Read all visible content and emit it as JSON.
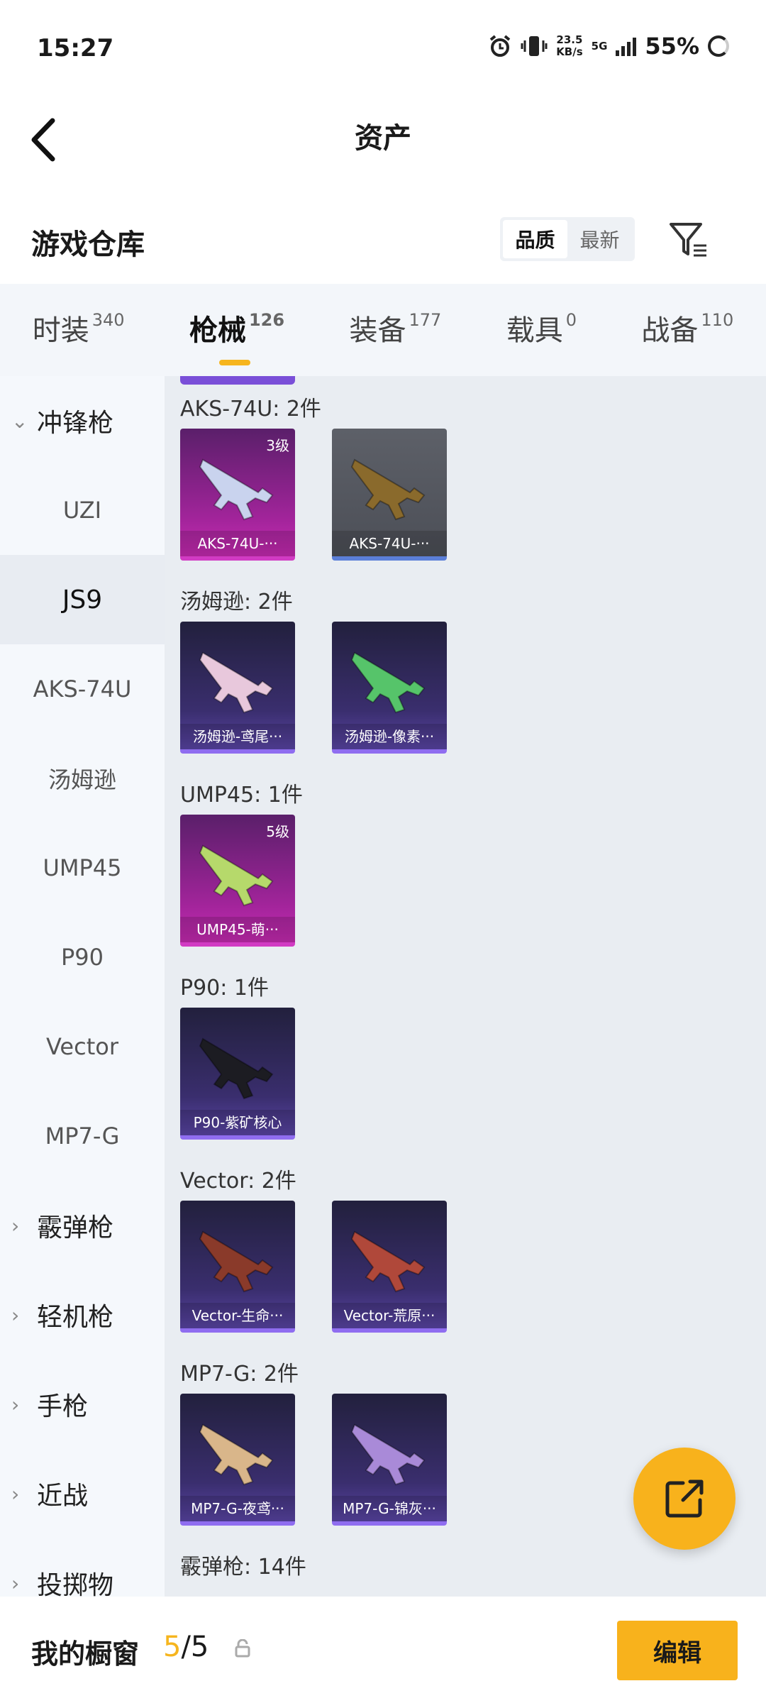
{
  "status_bar": {
    "time": "15:27",
    "net_speed_value": "23.5",
    "net_speed_unit": "KB/s",
    "network": "5G",
    "battery": "55%"
  },
  "header": {
    "title": "资产"
  },
  "warehouse": {
    "title": "游戏仓库",
    "sort_options": [
      "品质",
      "最新"
    ],
    "selected_sort": "品质"
  },
  "tabs": [
    {
      "label": "时装",
      "count": "340"
    },
    {
      "label": "枪械",
      "count": "126",
      "active": true
    },
    {
      "label": "装备",
      "count": "177"
    },
    {
      "label": "载具",
      "count": "0"
    },
    {
      "label": "战备",
      "count": "110"
    }
  ],
  "sidebar": {
    "items": [
      {
        "label": "冲锋枪",
        "type": "category",
        "expanded": true
      },
      {
        "label": "UZI",
        "type": "sub"
      },
      {
        "label": "JS9",
        "type": "sub",
        "selected": true
      },
      {
        "label": "AKS-74U",
        "type": "sub"
      },
      {
        "label": "汤姆逊",
        "type": "sub"
      },
      {
        "label": "UMP45",
        "type": "sub"
      },
      {
        "label": "P90",
        "type": "sub"
      },
      {
        "label": "Vector",
        "type": "sub"
      },
      {
        "label": "MP7-G",
        "type": "sub"
      },
      {
        "label": "霰弹枪",
        "type": "category"
      },
      {
        "label": "轻机枪",
        "type": "category"
      },
      {
        "label": "手枪",
        "type": "category"
      },
      {
        "label": "近战",
        "type": "category"
      },
      {
        "label": "投掷物",
        "type": "category"
      }
    ]
  },
  "sections": [
    {
      "title": "AKS-74U: 2件",
      "items": [
        {
          "label": "AKS-74U-···",
          "level": "3级",
          "rarity": "pink",
          "gun_color": "#c9d3ee"
        },
        {
          "label": "AKS-74U-···",
          "level": "",
          "rarity": "gray",
          "gun_color": "#8a6a2c"
        }
      ]
    },
    {
      "title": "汤姆逊: 2件",
      "items": [
        {
          "label": "汤姆逊-鸢尾···",
          "level": "",
          "rarity": "purple",
          "gun_color": "#e8c8dc"
        },
        {
          "label": "汤姆逊-像素···",
          "level": "",
          "rarity": "purple",
          "gun_color": "#56c46a"
        }
      ]
    },
    {
      "title": "UMP45: 1件",
      "items": [
        {
          "label": "UMP45-萌···",
          "level": "5级",
          "rarity": "pink",
          "gun_color": "#b6d96b"
        }
      ]
    },
    {
      "title": "P90: 1件",
      "items": [
        {
          "label": "P90-紫矿核心",
          "level": "",
          "rarity": "purple",
          "gun_color": "#1c1c22"
        }
      ]
    },
    {
      "title": "Vector: 2件",
      "items": [
        {
          "label": "Vector-生命···",
          "level": "",
          "rarity": "purple",
          "gun_color": "#8a3a2a"
        },
        {
          "label": "Vector-荒原···",
          "level": "",
          "rarity": "purple",
          "gun_color": "#b0483a"
        }
      ]
    },
    {
      "title": "MP7-G: 2件",
      "items": [
        {
          "label": "MP7-G-夜鸢···",
          "level": "",
          "rarity": "purple",
          "gun_color": "#d9b68a"
        },
        {
          "label": "MP7-G-锦灰···",
          "level": "",
          "rarity": "purple",
          "gun_color": "#a98ad8"
        }
      ]
    },
    {
      "title": "霰弹枪: 14件",
      "items": []
    }
  ],
  "bottom_bar": {
    "showcase_label": "我的橱窗",
    "current": "5",
    "separator_total": "/5",
    "edit_label": "编辑"
  },
  "colors": {
    "accent": "#f8b21c",
    "pink_rarity": "#c72bb2",
    "purple_rarity": "#8f6df0"
  }
}
